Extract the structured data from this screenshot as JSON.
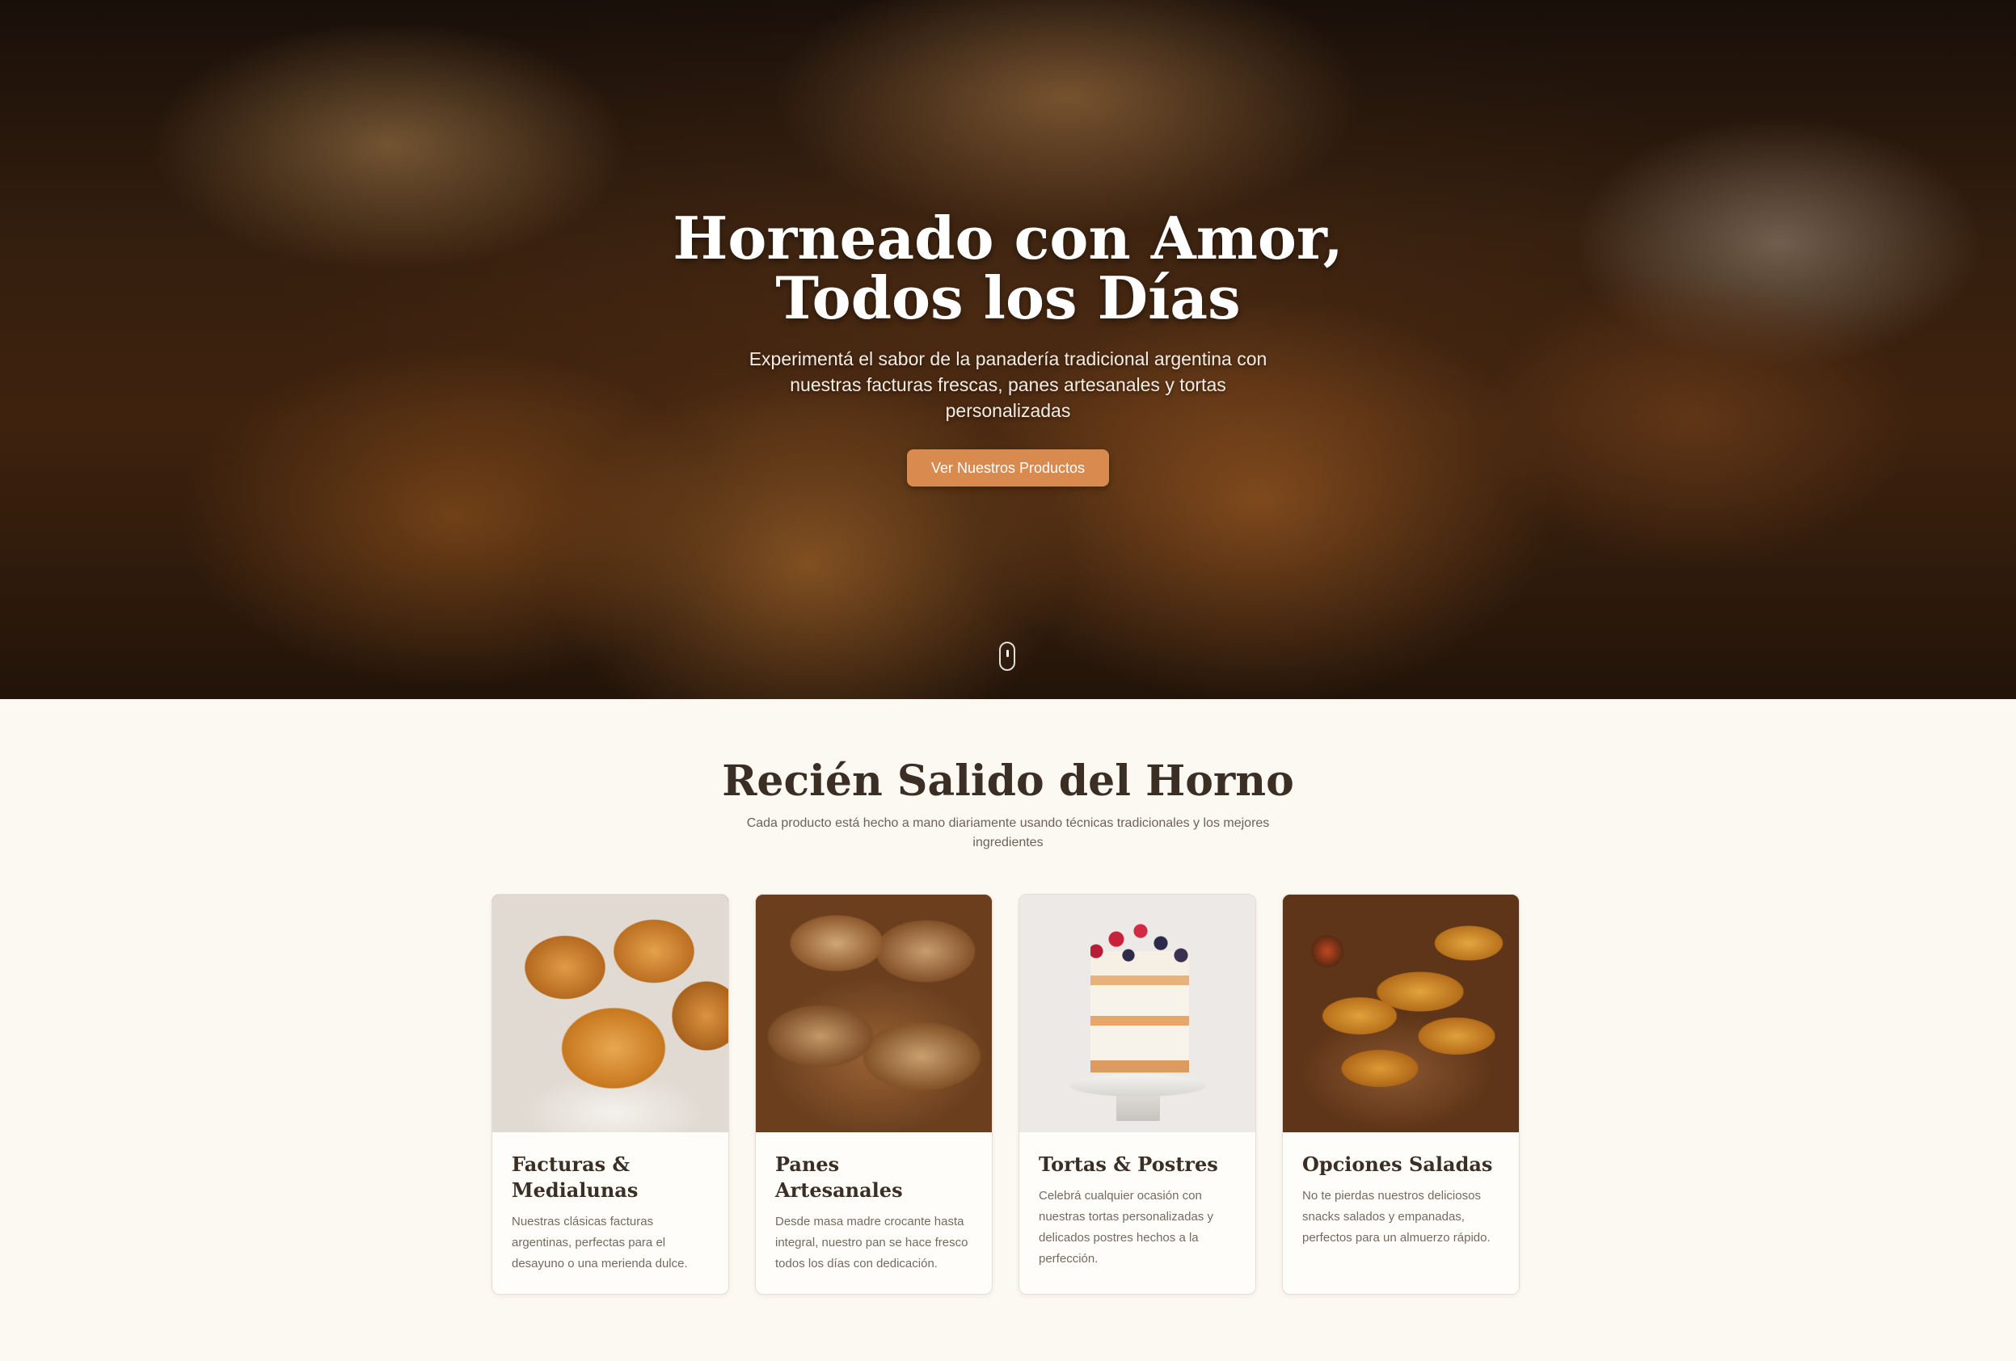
{
  "hero": {
    "title_line1": "Horneado con Amor,",
    "title_line2": "Todos los Días",
    "subtitle": "Experimentá el sabor de la panadería tradicional argentina con nuestras facturas frescas, panes artesanales y tortas personalizadas",
    "cta_label": "Ver Nuestros Productos",
    "cta_color": "#d98a4e"
  },
  "section": {
    "title": "Recién Salido del Horno",
    "subtitle": "Cada producto está hecho a mano diariamente usando técnicas tradicionales y los mejores ingredientes"
  },
  "products": [
    {
      "title": "Facturas & Medialunas",
      "description": "Nuestras clásicas facturas argentinas, perfectas para el desayuno o una merienda dulce."
    },
    {
      "title": "Panes Artesanales",
      "description": "Desde masa madre crocante hasta integral, nuestro pan se hace fresco todos los días con dedicación."
    },
    {
      "title": "Tortas & Postres",
      "description": "Celebrá cualquier ocasión con nuestras tortas personalizadas y delicados postres hechos a la perfección."
    },
    {
      "title": "Opciones Saladas",
      "description": "No te pierdas nuestros deliciosos snacks salados y empanadas, perfectos para un almuerzo rápido."
    }
  ],
  "colors": {
    "background": "#fcf8f2",
    "heading": "#3b2e24",
    "body_text": "#756a60"
  }
}
